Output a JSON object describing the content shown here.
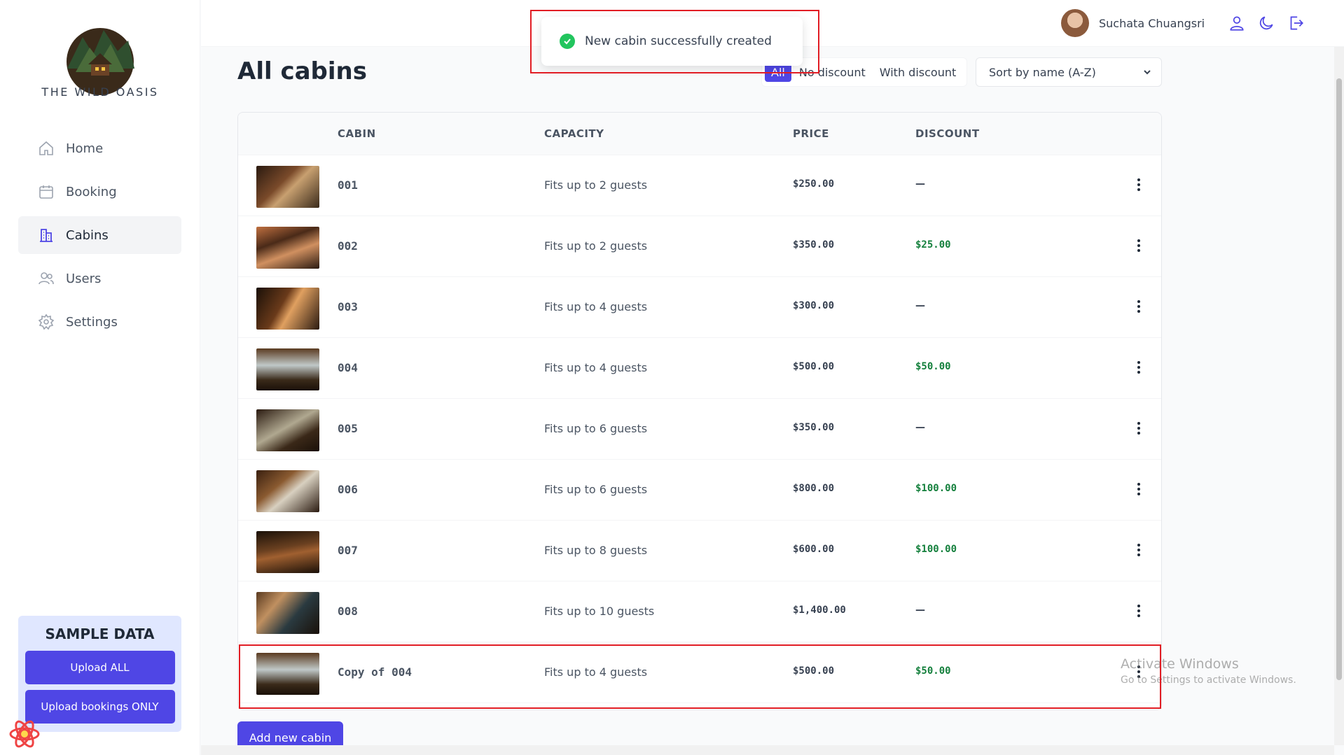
{
  "brand": {
    "name": "THE WILD OASIS"
  },
  "sidebar": {
    "items": [
      {
        "label": "Home",
        "icon": "home-icon"
      },
      {
        "label": "Booking",
        "icon": "calendar-icon"
      },
      {
        "label": "Cabins",
        "icon": "building-icon",
        "active": true
      },
      {
        "label": "Users",
        "icon": "users-icon"
      },
      {
        "label": "Settings",
        "icon": "gear-icon"
      }
    ]
  },
  "sample_data": {
    "title": "SAMPLE DATA",
    "upload_all": "Upload ALL",
    "upload_bookings": "Upload bookings ONLY"
  },
  "header": {
    "user_name": "Suchata Chuangsri"
  },
  "toast": {
    "message": "New cabin successfully created"
  },
  "page": {
    "title": "All cabins"
  },
  "filter": {
    "options": [
      "All",
      "No discount",
      "With discount"
    ],
    "active": "All"
  },
  "sort": {
    "selected": "Sort by name (A-Z)"
  },
  "table": {
    "columns": [
      "CABIN",
      "CAPACITY",
      "PRICE",
      "DISCOUNT"
    ],
    "rows": [
      {
        "name": "001",
        "capacity": "Fits up to 2 guests",
        "price": "$250.00",
        "discount": "—"
      },
      {
        "name": "002",
        "capacity": "Fits up to 2 guests",
        "price": "$350.00",
        "discount": "$25.00"
      },
      {
        "name": "003",
        "capacity": "Fits up to 4 guests",
        "price": "$300.00",
        "discount": "—"
      },
      {
        "name": "004",
        "capacity": "Fits up to 4 guests",
        "price": "$500.00",
        "discount": "$50.00"
      },
      {
        "name": "005",
        "capacity": "Fits up to 6 guests",
        "price": "$350.00",
        "discount": "—"
      },
      {
        "name": "006",
        "capacity": "Fits up to 6 guests",
        "price": "$800.00",
        "discount": "$100.00"
      },
      {
        "name": "007",
        "capacity": "Fits up to 8 guests",
        "price": "$600.00",
        "discount": "$100.00"
      },
      {
        "name": "008",
        "capacity": "Fits up to 10 guests",
        "price": "$1,400.00",
        "discount": "—"
      },
      {
        "name": "Copy of 004",
        "capacity": "Fits up to 4 guests",
        "price": "$500.00",
        "discount": "$50.00"
      }
    ]
  },
  "add_button": "Add new cabin",
  "watermark": {
    "line1": "Activate Windows",
    "line2": "Go to Settings to activate Windows."
  },
  "colors": {
    "accent": "#4f46e5",
    "discount": "#15803d",
    "highlight": "#e11d24"
  }
}
